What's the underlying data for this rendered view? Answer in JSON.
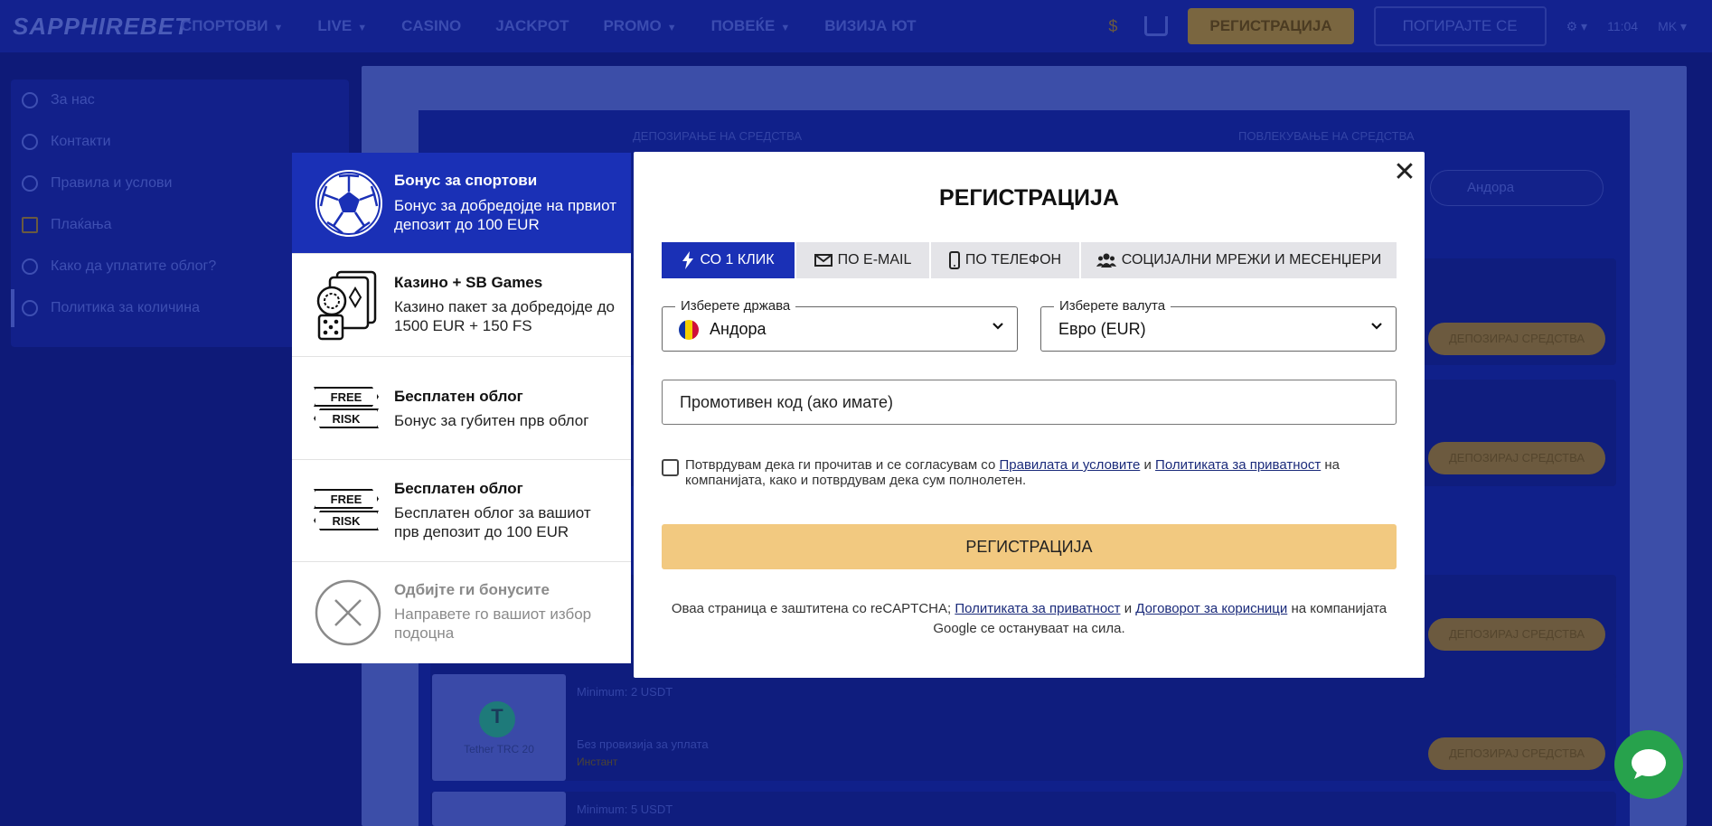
{
  "header": {
    "logo": "SAPPHIREBET",
    "nav": [
      {
        "label": "СПОРТОВИ",
        "has_caret": true
      },
      {
        "label": "LIVE",
        "has_caret": true
      },
      {
        "label": "CASINO",
        "has_caret": false
      },
      {
        "label": "JACKPOT",
        "has_caret": false
      },
      {
        "label": "PROMO",
        "has_caret": true
      },
      {
        "label": "ПОВЕЌЕ",
        "has_caret": true
      },
      {
        "label": "ВИЗИЈА ЮТ",
        "has_caret": false
      }
    ],
    "currency_symbol": "$",
    "register_label": "РЕГИСТРАЦИЈА",
    "login_label": "ПОГИРАЈТЕ СЕ",
    "time": "11:04",
    "lang": "MK"
  },
  "sidebar": {
    "items": [
      {
        "label": "За нас",
        "icon": "info-icon"
      },
      {
        "label": "Контакти",
        "icon": "phone-icon"
      },
      {
        "label": "Правила и услови",
        "icon": "document-icon"
      },
      {
        "label": "Плаќања",
        "icon": "dollar-icon"
      },
      {
        "label": "Како да уплатите облог?",
        "icon": "question-icon"
      },
      {
        "label": "Политика за количина",
        "icon": "megaphone-icon"
      }
    ]
  },
  "background": {
    "deposit_tab": "ДЕПОЗИРАЊЕ НА СРЕДСТВА",
    "withdraw_tab": "ПОВЛЕКУВАЊЕ НА СРЕДСТВА",
    "country_select": "Андора",
    "deposit_button": "ДЕПОЗИРАЈ СРЕДСТВА",
    "rows": [
      {
        "min": "Minimum: 2 USDT",
        "logo": "Tether TRC 20",
        "fee": "Без провизија за уплата",
        "extra": "Инстант"
      },
      {
        "min": "Minimum: 5 USDT"
      }
    ]
  },
  "bonuses": [
    {
      "title": "Бонус за спортови",
      "desc": "Бонус за добредојде на првиот депозит до 100 EUR",
      "icon": "soccer-ball-icon",
      "selected": true
    },
    {
      "title": "Казино + SB Games",
      "desc": "Казино пакет за добредојде до 1500 EUR + 150 FS",
      "icon": "casino-cards-icon",
      "selected": false
    },
    {
      "title": "Бесплатен облог",
      "desc": "Бонус за губитен прв облог",
      "icon": "free-risk-icon",
      "selected": false
    },
    {
      "title": "Бесплатен облог",
      "desc": "Бесплатен облог за вашиот прв депозит до 100 EUR",
      "icon": "free-risk-icon",
      "selected": false
    },
    {
      "title": "Одбијте ги бонусите",
      "desc": "Направете го вашиот избор подоцна",
      "icon": "decline-x-icon",
      "selected": false
    }
  ],
  "free_risk": {
    "top": "FREE",
    "bottom": "RISK"
  },
  "modal": {
    "title": "РЕГИСТРАЦИЈА",
    "tabs": [
      {
        "label": "СО 1 КЛИК",
        "icon": "lightning-icon",
        "active": true
      },
      {
        "label": "ПО E-MAIL",
        "icon": "envelope-icon",
        "active": false
      },
      {
        "label": "ПО ТЕЛЕФОН",
        "icon": "phone-icon",
        "active": false
      },
      {
        "label": "СОЦИЈАЛНИ МРЕЖИ И МЕСЕНЏЕРИ",
        "icon": "users-icon",
        "active": false
      }
    ],
    "country_label": "Изберете држава",
    "country_value": "Андора",
    "currency_label": "Изберете валута",
    "currency_value": "Евро (EUR)",
    "promo_placeholder": "Промотивен код (ако имате)",
    "terms": {
      "before": "Потврдувам дека ги прочитав и се согласувам со ",
      "link1": "Правилата и условите",
      "middle": " и ",
      "link2": "Политиката за приватност",
      "after": " на компанијата, како и потврдувам дека сум полнолетен."
    },
    "register_button": "РЕГИСТРАЦИЈА",
    "recaptcha": {
      "before": "Оваа страница е заштитена со reCAPTCHA; ",
      "link1": "Политиката за приватност",
      "middle": " и ",
      "link2": "Договорот за корисници",
      "after": " на компанијата Google се остануваат на сила."
    }
  },
  "colors": {
    "overlay_bg": "#0e1a78",
    "accent_blue": "#1a30b6",
    "register_gold": "#f2c980",
    "chat_green": "#27a24c"
  }
}
